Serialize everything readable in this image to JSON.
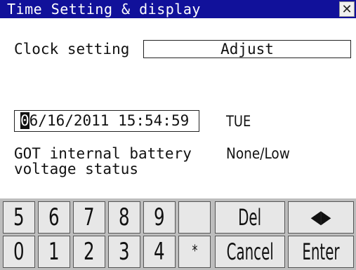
{
  "window": {
    "title": "Time Setting & display",
    "close_icon": "close-icon"
  },
  "clock": {
    "label": "Clock setting",
    "button_label": "Adjust"
  },
  "datetime": {
    "cursor_char": "0",
    "rest": "6/16/2011 15:54:59",
    "weekday": "TUE"
  },
  "battery": {
    "label_line1": "GOT internal battery",
    "label_line2": "voltage status",
    "value": "None/Low"
  },
  "keypad": {
    "row1": [
      "5",
      "6",
      "7",
      "8",
      "9",
      "",
      "Del",
      "◀▶"
    ],
    "row2": [
      "0",
      "1",
      "2",
      "3",
      "4",
      "*",
      "Cancel",
      "Enter"
    ]
  }
}
